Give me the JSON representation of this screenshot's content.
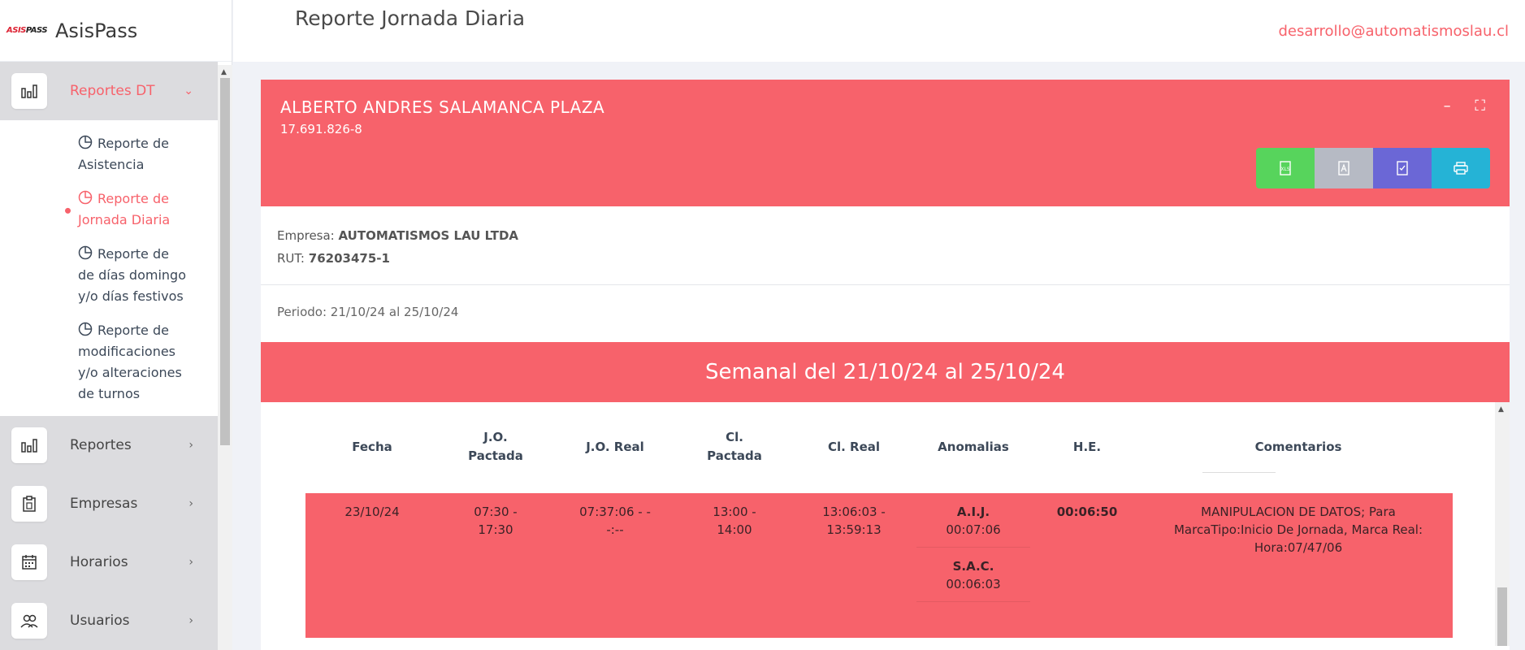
{
  "brand": {
    "logo_text": "ASIS",
    "logo_text2": "PASS",
    "name": "AsisPass"
  },
  "header": {
    "page_title": "Reporte Jornada Diaria",
    "user_email": "desarrollo@automatismoslau.cl"
  },
  "sidebar": {
    "groups": [
      {
        "label": "Reportes DT",
        "icon": "bar-chart-icon",
        "expanded": true,
        "items": [
          {
            "label_line1": "Reporte de",
            "label_rest": "Asistencia"
          },
          {
            "label_line1": "Reporte de",
            "label_rest": "Jornada Diaria",
            "active": true
          },
          {
            "label_line1": "Reporte de",
            "label_rest": "de días domingo y/o días festivos"
          },
          {
            "label_line1": "Reporte de",
            "label_rest": "modificaciones y/o alteraciones de turnos"
          }
        ]
      },
      {
        "label": "Reportes",
        "icon": "bar-chart-icon"
      },
      {
        "label": "Empresas",
        "icon": "clipboard-icon"
      },
      {
        "label": "Horarios",
        "icon": "calendar-icon"
      },
      {
        "label": "Usuarios",
        "icon": "users-icon"
      }
    ]
  },
  "employee": {
    "name": "ALBERTO ANDRES SALAMANCA PLAZA",
    "rut": "17.691.826-8"
  },
  "company": {
    "empresa_label": "Empresa:",
    "empresa_value": "AUTOMATISMOS LAU LTDA",
    "rut_label": "RUT:",
    "rut_value": "76203475-1",
    "period": "Periodo: 21/10/24 al 25/10/24"
  },
  "week_title": "Semanal del 21/10/24 al 25/10/24",
  "table": {
    "headers": [
      "Fecha",
      "J.O.\nPactada",
      "J.O. Real",
      "Cl.\nPactada",
      "Cl. Real",
      "Anomalias",
      "H.E.",
      "Comentarios"
    ],
    "rows": [
      {
        "fecha": "23/10/24",
        "jo_pactada": "07:30 - 17:30",
        "jo_real": "07:37:06 - --:--",
        "cl_pactada": "13:00 - 14:00",
        "cl_real": "13:06:03 - 13:59:13",
        "anomalias": [
          {
            "code": "A.I.J.",
            "value": "00:07:06"
          },
          {
            "code": "S.A.C.",
            "value": "00:06:03"
          }
        ],
        "he": "00:06:50",
        "comentarios": "MANIPULACION DE DATOS; Para MarcaTipo:Inicio De Jornada, Marca Real: Hora:07/47/06"
      }
    ]
  },
  "colors": {
    "accent": "#f7626b",
    "excel": "#57d45c",
    "pdf": "#b6bac4",
    "doc": "#6b67d6",
    "print": "#25b3d6"
  }
}
